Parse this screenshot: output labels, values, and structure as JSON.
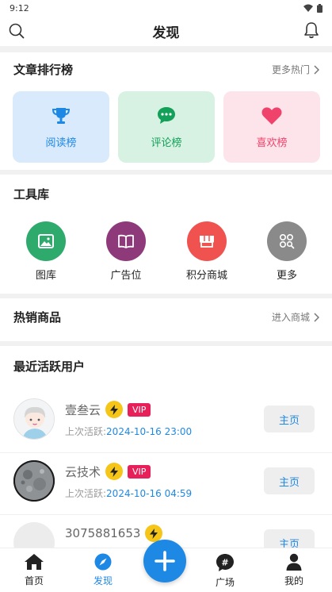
{
  "status_bar": {
    "time": "9:12"
  },
  "header": {
    "title": "发现"
  },
  "ranking": {
    "title": "文章排行榜",
    "more": "更多热门",
    "cards": [
      {
        "label": "阅读榜",
        "icon": "trophy-icon",
        "bg": "#d9eafc",
        "color": "#1e88e5"
      },
      {
        "label": "评论榜",
        "icon": "comment-icon",
        "bg": "#d7f2e3",
        "color": "#13a058"
      },
      {
        "label": "喜欢榜",
        "icon": "heart-icon",
        "bg": "#fde3ea",
        "color": "#f0436c"
      }
    ]
  },
  "tools": {
    "title": "工具库",
    "items": [
      {
        "label": "图库",
        "icon": "image-icon",
        "color": "#2eaa6d"
      },
      {
        "label": "广告位",
        "icon": "book-icon",
        "color": "#8e3a7a"
      },
      {
        "label": "积分商城",
        "icon": "store-icon",
        "color": "#f0524f"
      },
      {
        "label": "更多",
        "icon": "grid-search-icon",
        "color": "#8a8a8a"
      }
    ]
  },
  "hot_goods": {
    "title": "热销商品",
    "more": "进入商城"
  },
  "active_users": {
    "title": "最近活跃用户",
    "active_prefix": "上次活跃:",
    "home_label": "主页",
    "users": [
      {
        "name": "壹叁云",
        "vip": "VIP",
        "last_active": "2024-10-16 23:00"
      },
      {
        "name": "云技术",
        "vip": "VIP",
        "last_active": "2024-10-16 04:59"
      },
      {
        "name": "3075881653",
        "vip": "",
        "last_active": ""
      }
    ]
  },
  "bottom_nav": {
    "items": [
      {
        "label": "首页",
        "icon": "home-icon"
      },
      {
        "label": "发现",
        "icon": "compass-icon"
      },
      {
        "label": "广场",
        "icon": "hashtag-icon"
      },
      {
        "label": "我的",
        "icon": "user-icon"
      }
    ],
    "fab_icon": "plus-icon",
    "active_color": "#1e88e5"
  }
}
